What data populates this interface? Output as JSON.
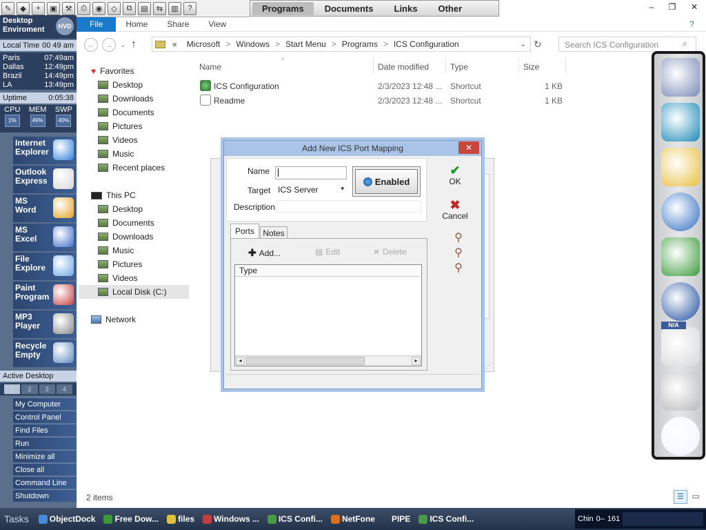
{
  "top_toolbar": {
    "icons": [
      "pencil-icon",
      "shield-icon",
      "plus-icon",
      "dialog-icon",
      "tools-icon",
      "printer-icon",
      "globe-icon",
      "diamond-icon",
      "copy-icon",
      "box-icon",
      "arrows-icon",
      "book-icon",
      "question-icon"
    ],
    "icon_glyphs": [
      "✎",
      "◆",
      "+",
      "▣",
      "⚒",
      "⎙",
      "◉",
      "◇",
      "⧉",
      "▤",
      "⇆",
      "▥",
      "?"
    ]
  },
  "top_menu": {
    "items": [
      "Programs",
      "Documents",
      "Links",
      "Other"
    ],
    "active": "Programs"
  },
  "left_panel": {
    "header_line1": "Desktop",
    "header_line2": "Enviroment",
    "badge": "HVD",
    "local_time_label": "Local Time",
    "local_time_value": "00 49 am",
    "cities": [
      {
        "name": "Paris",
        "time": "07:49am"
      },
      {
        "name": "Dallas",
        "time": "12:49pm"
      },
      {
        "name": "Brazil",
        "time": "14:49pm"
      },
      {
        "name": "LA",
        "time": "13:49pm"
      }
    ],
    "uptime_label": "Uptime",
    "uptime_value": "0:05:38",
    "meters": [
      {
        "label": "CPU",
        "value": "1%"
      },
      {
        "label": "MEM",
        "value": "49%"
      },
      {
        "label": "SWP",
        "value": "40%"
      }
    ],
    "apps": [
      {
        "line1": "Internet",
        "line2": "Explorer",
        "icon": "globe-icon",
        "color": "#2f7fd9"
      },
      {
        "line1": "Outlook",
        "line2": "Express",
        "icon": "printer-icon",
        "color": "#d8d8d8"
      },
      {
        "line1": "MS",
        "line2": "Word",
        "icon": "word-icon",
        "color": "#e6a020"
      },
      {
        "line1": "MS",
        "line2": "Excel",
        "icon": "excel-icon",
        "color": "#3a6bc8"
      },
      {
        "line1": "File",
        "line2": "Explore",
        "icon": "window-icon",
        "color": "#6aa6e6"
      },
      {
        "line1": "Paint",
        "line2": "Program",
        "icon": "paint-icon",
        "color": "#c84040"
      },
      {
        "line1": "MP3",
        "line2": "Player",
        "icon": "speaker-icon",
        "color": "#888888"
      },
      {
        "line1": "Recycle",
        "line2": "Empty",
        "icon": "bin-icon",
        "color": "#5a8ac0"
      }
    ],
    "active_desktop_label": "Active Desktop",
    "desktops": [
      "1",
      "2",
      "3",
      "4"
    ],
    "menu": [
      "My Computer",
      "Control Panel",
      "Find Files",
      "Run",
      "Minimize all",
      "Close all",
      "Command Line",
      "Shutdown"
    ]
  },
  "explorer": {
    "ribbon_tabs": [
      "File",
      "Home",
      "Share",
      "View"
    ],
    "address": [
      "«",
      "Microsoft",
      ">",
      "Windows",
      ">",
      "Start Menu",
      ">",
      "Programs",
      ">",
      "ICS Configuration"
    ],
    "search_placeholder": "Search ICS Configuration",
    "window_controls": [
      "–",
      "❐",
      "✕"
    ],
    "nav_favorites": {
      "title": "Favorites",
      "items": [
        "Desktop",
        "Downloads",
        "Documents",
        "Pictures",
        "Videos",
        "Music",
        "Recent places"
      ]
    },
    "nav_pc": {
      "title": "This PC",
      "items": [
        "Desktop",
        "Documents",
        "Downloads",
        "Music",
        "Pictures",
        "Videos",
        "Local Disk (C:)"
      ]
    },
    "nav_network": "Network",
    "columns": [
      "Name",
      "Date modified",
      "Type",
      "Size"
    ],
    "files": [
      {
        "name": "ICS Configuration",
        "date": "2/3/2023 12:48 ...",
        "type": "Shortcut",
        "size": "1 KB"
      },
      {
        "name": "Readme",
        "date": "2/3/2023 12:48 ...",
        "type": "Shortcut",
        "size": "1 KB"
      }
    ],
    "status": "2 items"
  },
  "dialog": {
    "title": "Add New ICS Port Mapping",
    "name_label": "Name",
    "name_value": "",
    "target_label": "Target",
    "target_value": "ICS Server",
    "description_label": "Description",
    "description_value": "",
    "enabled_label": "Enabled",
    "ok_label": "OK",
    "cancel_label": "Cancel",
    "tabs": [
      "Ports",
      "Notes"
    ],
    "add_label": "Add...",
    "edit_label": "Edit",
    "delete_label": "Delete",
    "list_header": "Type"
  },
  "dock": {
    "items": [
      "ruler-icon",
      "exit-icon",
      "folder-icon",
      "globe-icon",
      "network-icon",
      "windows-icon",
      "gear-icon",
      "trash-icon",
      "clock-icon"
    ],
    "na_label": "N/A"
  },
  "taskbar": {
    "tasks_label": "Tasks",
    "items": [
      {
        "label": "ObjectDock",
        "color": "#4a8ad8"
      },
      {
        "label": "Free Dow...",
        "color": "#3a9a3a"
      },
      {
        "label": "files",
        "color": "#e0c040"
      },
      {
        "label": "Windows ...",
        "color": "#c04040"
      },
      {
        "label": "ICS Confi...",
        "color": "#4a9a4a"
      },
      {
        "label": "NetFone",
        "color": "#d87020"
      },
      {
        "label": "PIPE",
        "color": ""
      },
      {
        "label": "ICS Confi...",
        "color": "#4a9a4a"
      }
    ],
    "tray_lang": "Chin",
    "tray_extra": "0–",
    "tray_time": "161"
  },
  "colors": {
    "accent": "#1979ca",
    "panel": "#2c3f5f",
    "dialog_title": "#a9c4e6",
    "close": "#c9463d"
  }
}
